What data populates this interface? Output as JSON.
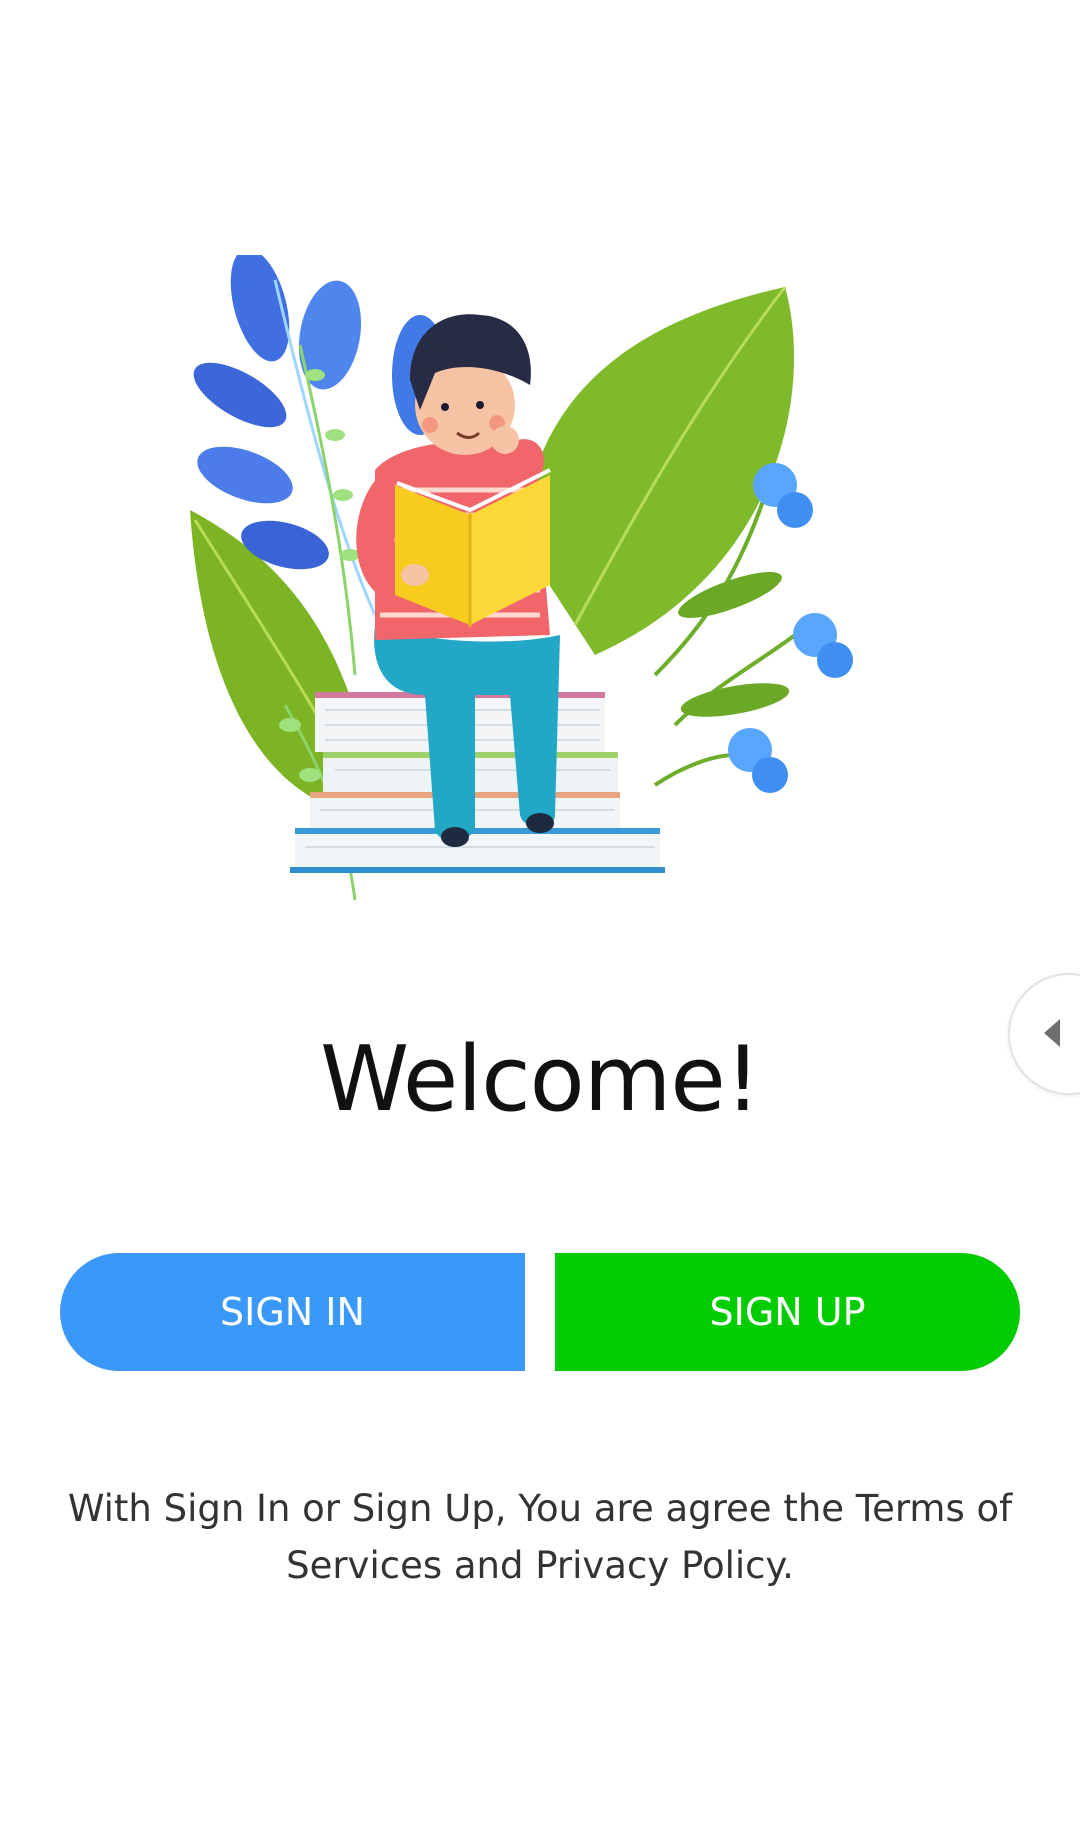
{
  "welcome": {
    "title": "Welcome!"
  },
  "actions": {
    "sign_in_label": "SIGN IN",
    "sign_up_label": "SIGN UP"
  },
  "terms": {
    "text": "With Sign In or Sign Up, You are agree the Terms of Services and Privacy Policy."
  },
  "illustration": {
    "icon": "boy-reading-book-illustration"
  },
  "side_handle": {
    "icon": "chevron-left-icon"
  },
  "colors": {
    "sign_in": "#3a99f8",
    "sign_up": "#03cc03",
    "background": "#ffffff"
  }
}
